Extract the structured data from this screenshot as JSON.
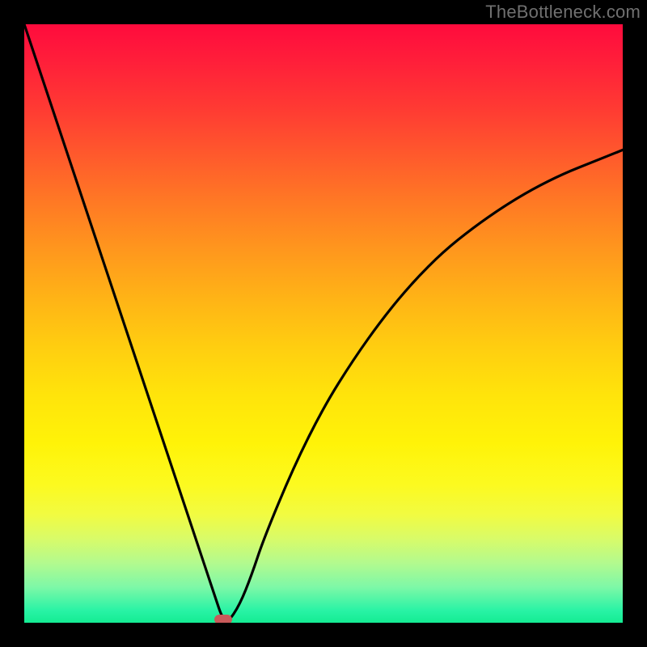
{
  "watermark": "TheBottleneck.com",
  "chart_data": {
    "type": "line",
    "title": "",
    "xlabel": "",
    "ylabel": "",
    "xlim": [
      0,
      100
    ],
    "ylim": [
      0,
      100
    ],
    "grid": false,
    "legend": false,
    "series": [
      {
        "name": "bottleneck-curve",
        "x": [
          0,
          5,
          10,
          15,
          20,
          25,
          30,
          32,
          33,
          34,
          36,
          38,
          40,
          45,
          50,
          55,
          60,
          65,
          70,
          75,
          80,
          85,
          90,
          95,
          100
        ],
        "values": [
          100,
          85,
          70,
          55,
          40,
          25,
          10,
          4,
          1,
          0,
          3,
          8,
          14,
          26,
          36,
          44,
          51,
          57,
          62,
          66,
          69.5,
          72.5,
          75,
          77,
          79
        ]
      }
    ],
    "background": {
      "type": "vertical-gradient",
      "stops": [
        {
          "pos": 0.0,
          "color": "#ff0b3d"
        },
        {
          "pos": 0.5,
          "color": "#ffce10"
        },
        {
          "pos": 0.8,
          "color": "#fcfa20"
        },
        {
          "pos": 1.0,
          "color": "#14ec93"
        }
      ]
    },
    "marker": {
      "name": "sweet-spot",
      "x": 33.3,
      "y": 0.5,
      "color": "#c85a5a"
    }
  },
  "colors": {
    "curve": "#000000",
    "frame": "#000000",
    "watermark": "#707070"
  }
}
